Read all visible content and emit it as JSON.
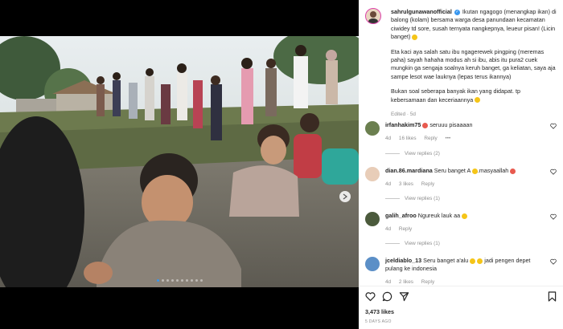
{
  "post": {
    "username": "sahrulgunawanofficial",
    "caption_paragraphs": [
      "Ikutan ngagogo (menangkap ikan) di balong (kolam) bersama warga desa panundaan kecamatan ciwidey td sore, susah ternyata nangkepnya, leueur pisan! (Licin banget)",
      "Eta kaci aya salah satu ibu ngagerewek pingping (meremas paha) sayah hahaha modus ah si ibu, abis itu pura2 cuek mungkin ga sengaja soalnya keruh banget, ga keliatan, saya aja sampe lesot wae lauknya (lepas terus ikannya)",
      "Bukan soal seberapa banyak ikan yang didapat. tp kebersamaan dan keceriaannya"
    ],
    "edited": "Edited",
    "age": "5d",
    "likes": "3,473 likes",
    "posted_ago": "5 DAYS AGO",
    "total_slides": 10,
    "current_slide": 1
  },
  "comments": [
    {
      "username": "irfanhakim75",
      "text": "seruuu pisaaaan",
      "age": "4d",
      "likes": "16 likes",
      "reply": "Reply",
      "more": "•••",
      "view_replies": "View replies (2)"
    },
    {
      "username": "dian.86.mardiana",
      "text": "Seru banget A",
      "text2": ".masyaallah",
      "age": "4d",
      "likes": "3 likes",
      "reply": "Reply",
      "view_replies": "View replies (1)"
    },
    {
      "username": "galih_afroo",
      "text": "Ngureuk lauk aa",
      "age": "4d",
      "reply": "Reply",
      "view_replies": "View replies (1)"
    },
    {
      "username": "jceldiablo_13",
      "text": "Seru banget a'alu",
      "text2": "jadi pengen depet pulang ke indonesia",
      "age": "4d",
      "likes": "2 likes",
      "reply": "Reply"
    }
  ],
  "icons": {
    "like": "heart-icon",
    "comment": "comment-icon",
    "share": "share-icon",
    "save": "bookmark-icon"
  },
  "colors": {
    "accent": "#3897f0",
    "muted": "#8e8e8e"
  }
}
